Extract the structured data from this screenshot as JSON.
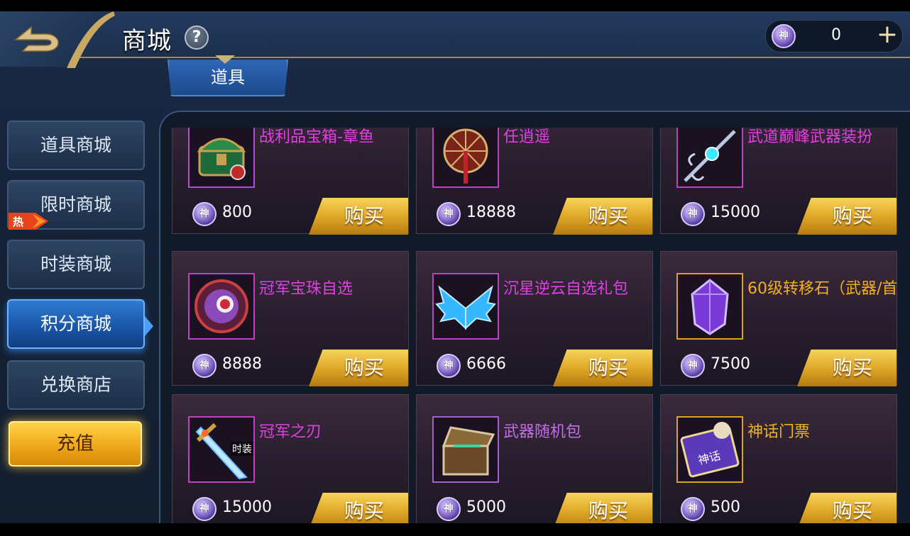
{
  "header": {
    "title": "商城",
    "help": "?",
    "currency": {
      "icon_label": "神",
      "value": "0",
      "add": "+"
    }
  },
  "tabs": [
    {
      "label": "道具"
    }
  ],
  "sidebar": {
    "items": [
      {
        "label": "道具商城"
      },
      {
        "label": "限时商城",
        "badge": "热"
      },
      {
        "label": "时装商城"
      },
      {
        "label": "积分商城",
        "active": true
      },
      {
        "label": "兑换商店"
      }
    ],
    "recharge": "充值"
  },
  "coin_label": "神",
  "buy_label": "购买",
  "items": [
    {
      "name": "战利品宝箱-章鱼",
      "price": "800",
      "name_color": "#e040e0",
      "frame_color": "#b050d0",
      "icon": "treasure-chest-icon"
    },
    {
      "name": "任逍遥",
      "price": "18888",
      "name_color": "#e040e0",
      "frame_color": "#c040c0",
      "icon": "umbrella-weapon-icon"
    },
    {
      "name": "武道巅峰武器装扮",
      "price": "15000",
      "name_color": "#e040e0",
      "frame_color": "#c040c0",
      "icon": "staff-weapon-icon"
    },
    {
      "name": "冠军宝珠自选",
      "price": "8888",
      "name_color": "#e040e0",
      "frame_color": "#c040c0",
      "icon": "orb-icon"
    },
    {
      "name": "沉星逆云自选礼包",
      "price": "6666",
      "name_color": "#e040e0",
      "frame_color": "#c040c0",
      "icon": "wings-icon"
    },
    {
      "name": "60级转移石（武器/首",
      "price": "7500",
      "name_color": "#f0b020",
      "frame_color": "#e0a020",
      "icon": "crystal-icon"
    },
    {
      "name": "冠军之刃",
      "price": "15000",
      "name_color": "#e040e0",
      "frame_color": "#c040c0",
      "icon": "sword-icon",
      "tag": "时装"
    },
    {
      "name": "武器随机包",
      "price": "5000",
      "name_color": "#c070e0",
      "frame_color": "#a060d0",
      "icon": "chest-icon"
    },
    {
      "name": "神话门票",
      "price": "500",
      "name_color": "#f0b020",
      "frame_color": "#e0a020",
      "icon": "ticket-icon",
      "ticket_text": "神话"
    }
  ]
}
